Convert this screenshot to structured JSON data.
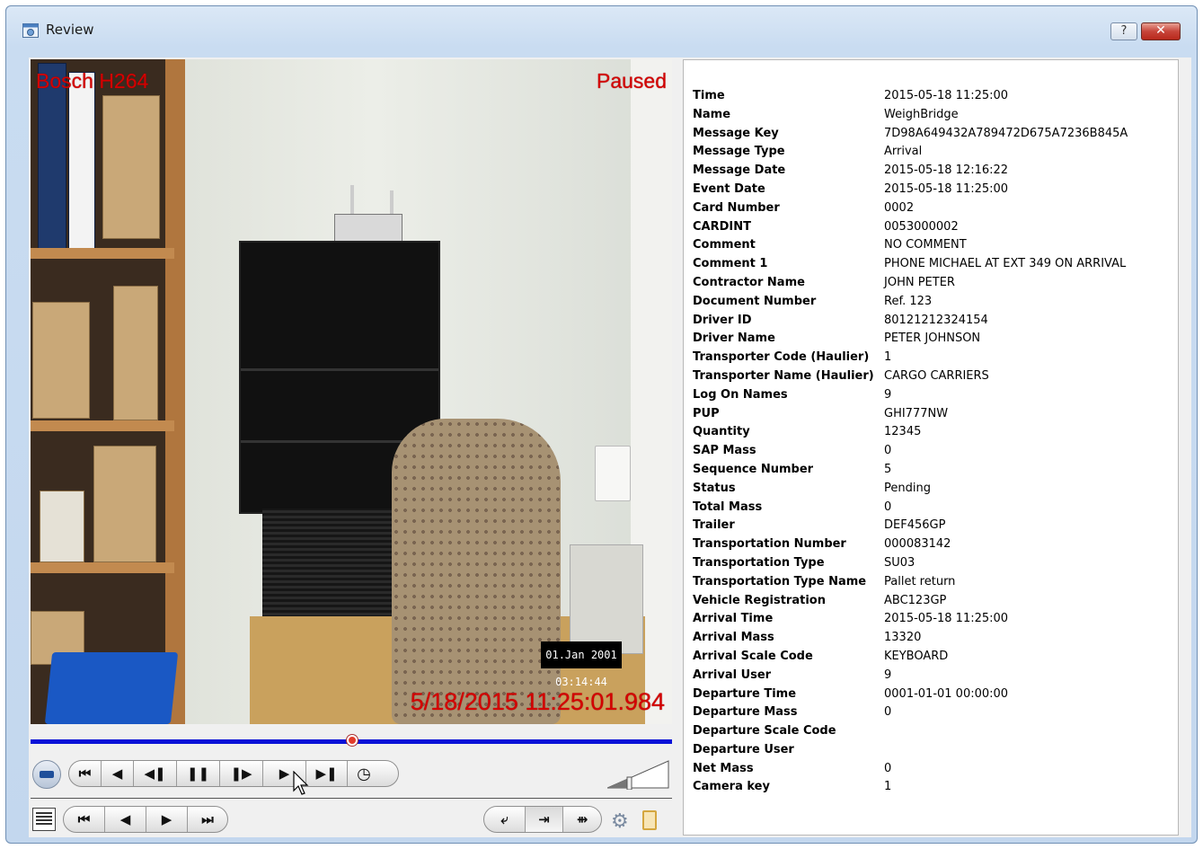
{
  "window": {
    "title": "Review",
    "help_label": "?",
    "close_label": "✕"
  },
  "video": {
    "codec": "Bosch H264",
    "status": "Paused",
    "timestamp": "5/18/2015 11:25:01.984",
    "camera_stamp": "01.Jan 2001 03:14:44"
  },
  "controls": {
    "playback": [
      "⏮",
      "◀",
      "◀❚",
      "❚❚",
      "❚▶",
      "▶",
      "▶❚",
      "◷"
    ],
    "step": [
      "⏮",
      "◀",
      "▶",
      "⏭"
    ],
    "mode": [
      "⤶",
      "⇥",
      "⇻"
    ]
  },
  "info": {
    "rows": [
      {
        "key": "Time",
        "value": "2015-05-18 11:25:00"
      },
      {
        "key": "Name",
        "value": "WeighBridge"
      },
      {
        "key": "Message Key",
        "value": "7D98A649432A789472D675A7236B845A"
      },
      {
        "key": "Message Type",
        "value": "Arrival"
      },
      {
        "key": "Message Date",
        "value": "2015-05-18 12:16:22"
      },
      {
        "key": "Event Date",
        "value": "2015-05-18 11:25:00"
      },
      {
        "key": "Card Number",
        "value": "0002"
      },
      {
        "key": "CARDINT",
        "value": "0053000002"
      },
      {
        "key": "Comment",
        "value": "NO COMMENT"
      },
      {
        "key": "Comment 1",
        "value": "PHONE MICHAEL AT EXT 349 ON ARRIVAL"
      },
      {
        "key": "Contractor Name",
        "value": "JOHN PETER"
      },
      {
        "key": "Document Number",
        "value": "Ref. 123"
      },
      {
        "key": "Driver ID",
        "value": "80121212324154"
      },
      {
        "key": "Driver Name",
        "value": "PETER JOHNSON"
      },
      {
        "key": "Transporter Code (Haulier)",
        "value": "1"
      },
      {
        "key": "Transporter Name (Haulier)",
        "value": "CARGO CARRIERS"
      },
      {
        "key": "Log On Names",
        "value": "9"
      },
      {
        "key": "PUP",
        "value": "GHI777NW"
      },
      {
        "key": "Quantity",
        "value": "12345"
      },
      {
        "key": "SAP Mass",
        "value": "0"
      },
      {
        "key": "Sequence Number",
        "value": "5"
      },
      {
        "key": "Status",
        "value": "Pending"
      },
      {
        "key": "Total Mass",
        "value": "0"
      },
      {
        "key": "Trailer",
        "value": "DEF456GP"
      },
      {
        "key": "Transportation Number",
        "value": "000083142"
      },
      {
        "key": "Transportation Type",
        "value": "SU03"
      },
      {
        "key": "Transportation Type Name",
        "value": "Pallet return"
      },
      {
        "key": "Vehicle Registration",
        "value": "ABC123GP"
      },
      {
        "key": "Arrival Time",
        "value": "2015-05-18 11:25:00"
      },
      {
        "key": "Arrival Mass",
        "value": "13320"
      },
      {
        "key": "Arrival Scale Code",
        "value": "KEYBOARD"
      },
      {
        "key": "Arrival User",
        "value": "9"
      },
      {
        "key": "Departure Time",
        "value": "0001-01-01 00:00:00"
      },
      {
        "key": "Departure Mass",
        "value": "0"
      },
      {
        "key": "Departure Scale Code",
        "value": ""
      },
      {
        "key": "Departure User",
        "value": ""
      },
      {
        "key": "Net Mass",
        "value": "0"
      },
      {
        "key": "Camera key",
        "value": "1"
      }
    ]
  }
}
